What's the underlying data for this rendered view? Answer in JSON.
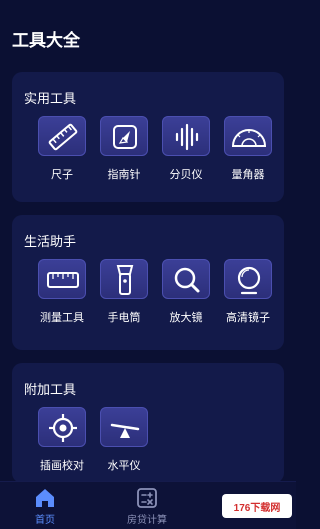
{
  "header": {
    "title": "工具大全"
  },
  "sections": [
    {
      "title": "实用工具",
      "items": [
        {
          "label": "尺子",
          "icon": "ruler-icon"
        },
        {
          "label": "指南针",
          "icon": "compass-icon"
        },
        {
          "label": "分贝仪",
          "icon": "sound-wave-icon"
        },
        {
          "label": "量角器",
          "icon": "protractor-icon"
        }
      ]
    },
    {
      "title": "生活助手",
      "items": [
        {
          "label": "测量工具",
          "icon": "measure-tape-icon"
        },
        {
          "label": "手电筒",
          "icon": "flashlight-icon"
        },
        {
          "label": "放大镜",
          "icon": "magnifier-icon"
        },
        {
          "label": "高清镜子",
          "icon": "mirror-icon"
        }
      ]
    },
    {
      "title": "附加工具",
      "items": [
        {
          "label": "插画校对",
          "icon": "crosshair-icon"
        },
        {
          "label": "水平仪",
          "icon": "level-icon"
        }
      ]
    }
  ],
  "bottom_nav": [
    {
      "label": "首页",
      "icon": "home-icon",
      "active": true
    },
    {
      "label": "房贷计算",
      "icon": "calculator-icon",
      "active": false
    }
  ],
  "watermark": {
    "text": "176下载网"
  },
  "colors": {
    "background": "#0b1033",
    "card": "#131a4a",
    "tile": "#3b3f97",
    "active_nav": "#5b8dfd"
  }
}
